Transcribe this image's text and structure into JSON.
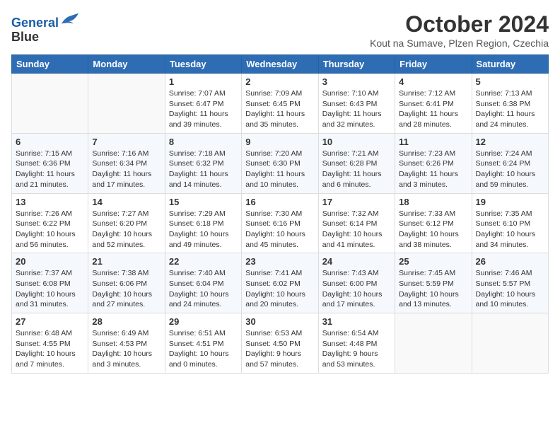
{
  "header": {
    "logo_line1": "General",
    "logo_line2": "Blue",
    "month_title": "October 2024",
    "location": "Kout na Sumave, Plzen Region, Czechia"
  },
  "days_of_week": [
    "Sunday",
    "Monday",
    "Tuesday",
    "Wednesday",
    "Thursday",
    "Friday",
    "Saturday"
  ],
  "weeks": [
    [
      {
        "day": "",
        "sunrise": "",
        "sunset": "",
        "daylight": ""
      },
      {
        "day": "",
        "sunrise": "",
        "sunset": "",
        "daylight": ""
      },
      {
        "day": "1",
        "sunrise": "Sunrise: 7:07 AM",
        "sunset": "Sunset: 6:47 PM",
        "daylight": "Daylight: 11 hours and 39 minutes."
      },
      {
        "day": "2",
        "sunrise": "Sunrise: 7:09 AM",
        "sunset": "Sunset: 6:45 PM",
        "daylight": "Daylight: 11 hours and 35 minutes."
      },
      {
        "day": "3",
        "sunrise": "Sunrise: 7:10 AM",
        "sunset": "Sunset: 6:43 PM",
        "daylight": "Daylight: 11 hours and 32 minutes."
      },
      {
        "day": "4",
        "sunrise": "Sunrise: 7:12 AM",
        "sunset": "Sunset: 6:41 PM",
        "daylight": "Daylight: 11 hours and 28 minutes."
      },
      {
        "day": "5",
        "sunrise": "Sunrise: 7:13 AM",
        "sunset": "Sunset: 6:38 PM",
        "daylight": "Daylight: 11 hours and 24 minutes."
      }
    ],
    [
      {
        "day": "6",
        "sunrise": "Sunrise: 7:15 AM",
        "sunset": "Sunset: 6:36 PM",
        "daylight": "Daylight: 11 hours and 21 minutes."
      },
      {
        "day": "7",
        "sunrise": "Sunrise: 7:16 AM",
        "sunset": "Sunset: 6:34 PM",
        "daylight": "Daylight: 11 hours and 17 minutes."
      },
      {
        "day": "8",
        "sunrise": "Sunrise: 7:18 AM",
        "sunset": "Sunset: 6:32 PM",
        "daylight": "Daylight: 11 hours and 14 minutes."
      },
      {
        "day": "9",
        "sunrise": "Sunrise: 7:20 AM",
        "sunset": "Sunset: 6:30 PM",
        "daylight": "Daylight: 11 hours and 10 minutes."
      },
      {
        "day": "10",
        "sunrise": "Sunrise: 7:21 AM",
        "sunset": "Sunset: 6:28 PM",
        "daylight": "Daylight: 11 hours and 6 minutes."
      },
      {
        "day": "11",
        "sunrise": "Sunrise: 7:23 AM",
        "sunset": "Sunset: 6:26 PM",
        "daylight": "Daylight: 11 hours and 3 minutes."
      },
      {
        "day": "12",
        "sunrise": "Sunrise: 7:24 AM",
        "sunset": "Sunset: 6:24 PM",
        "daylight": "Daylight: 10 hours and 59 minutes."
      }
    ],
    [
      {
        "day": "13",
        "sunrise": "Sunrise: 7:26 AM",
        "sunset": "Sunset: 6:22 PM",
        "daylight": "Daylight: 10 hours and 56 minutes."
      },
      {
        "day": "14",
        "sunrise": "Sunrise: 7:27 AM",
        "sunset": "Sunset: 6:20 PM",
        "daylight": "Daylight: 10 hours and 52 minutes."
      },
      {
        "day": "15",
        "sunrise": "Sunrise: 7:29 AM",
        "sunset": "Sunset: 6:18 PM",
        "daylight": "Daylight: 10 hours and 49 minutes."
      },
      {
        "day": "16",
        "sunrise": "Sunrise: 7:30 AM",
        "sunset": "Sunset: 6:16 PM",
        "daylight": "Daylight: 10 hours and 45 minutes."
      },
      {
        "day": "17",
        "sunrise": "Sunrise: 7:32 AM",
        "sunset": "Sunset: 6:14 PM",
        "daylight": "Daylight: 10 hours and 41 minutes."
      },
      {
        "day": "18",
        "sunrise": "Sunrise: 7:33 AM",
        "sunset": "Sunset: 6:12 PM",
        "daylight": "Daylight: 10 hours and 38 minutes."
      },
      {
        "day": "19",
        "sunrise": "Sunrise: 7:35 AM",
        "sunset": "Sunset: 6:10 PM",
        "daylight": "Daylight: 10 hours and 34 minutes."
      }
    ],
    [
      {
        "day": "20",
        "sunrise": "Sunrise: 7:37 AM",
        "sunset": "Sunset: 6:08 PM",
        "daylight": "Daylight: 10 hours and 31 minutes."
      },
      {
        "day": "21",
        "sunrise": "Sunrise: 7:38 AM",
        "sunset": "Sunset: 6:06 PM",
        "daylight": "Daylight: 10 hours and 27 minutes."
      },
      {
        "day": "22",
        "sunrise": "Sunrise: 7:40 AM",
        "sunset": "Sunset: 6:04 PM",
        "daylight": "Daylight: 10 hours and 24 minutes."
      },
      {
        "day": "23",
        "sunrise": "Sunrise: 7:41 AM",
        "sunset": "Sunset: 6:02 PM",
        "daylight": "Daylight: 10 hours and 20 minutes."
      },
      {
        "day": "24",
        "sunrise": "Sunrise: 7:43 AM",
        "sunset": "Sunset: 6:00 PM",
        "daylight": "Daylight: 10 hours and 17 minutes."
      },
      {
        "day": "25",
        "sunrise": "Sunrise: 7:45 AM",
        "sunset": "Sunset: 5:59 PM",
        "daylight": "Daylight: 10 hours and 13 minutes."
      },
      {
        "day": "26",
        "sunrise": "Sunrise: 7:46 AM",
        "sunset": "Sunset: 5:57 PM",
        "daylight": "Daylight: 10 hours and 10 minutes."
      }
    ],
    [
      {
        "day": "27",
        "sunrise": "Sunrise: 6:48 AM",
        "sunset": "Sunset: 4:55 PM",
        "daylight": "Daylight: 10 hours and 7 minutes."
      },
      {
        "day": "28",
        "sunrise": "Sunrise: 6:49 AM",
        "sunset": "Sunset: 4:53 PM",
        "daylight": "Daylight: 10 hours and 3 minutes."
      },
      {
        "day": "29",
        "sunrise": "Sunrise: 6:51 AM",
        "sunset": "Sunset: 4:51 PM",
        "daylight": "Daylight: 10 hours and 0 minutes."
      },
      {
        "day": "30",
        "sunrise": "Sunrise: 6:53 AM",
        "sunset": "Sunset: 4:50 PM",
        "daylight": "Daylight: 9 hours and 57 minutes."
      },
      {
        "day": "31",
        "sunrise": "Sunrise: 6:54 AM",
        "sunset": "Sunset: 4:48 PM",
        "daylight": "Daylight: 9 hours and 53 minutes."
      },
      {
        "day": "",
        "sunrise": "",
        "sunset": "",
        "daylight": ""
      },
      {
        "day": "",
        "sunrise": "",
        "sunset": "",
        "daylight": ""
      }
    ]
  ]
}
